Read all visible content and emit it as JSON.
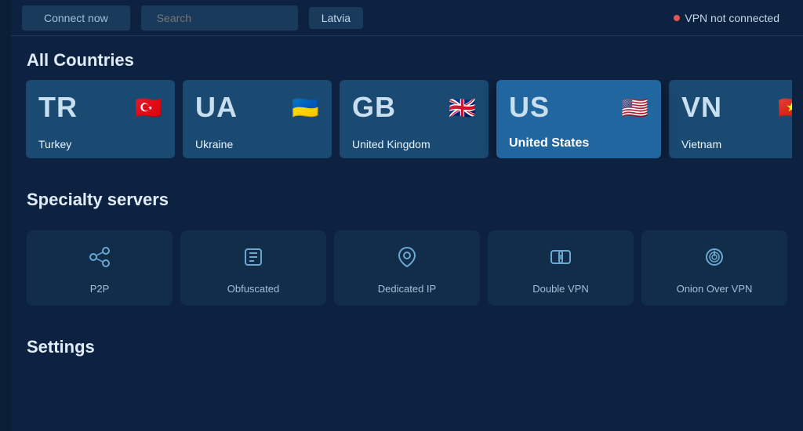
{
  "topbar": {
    "connect_label": "Connect now",
    "search_label": "Search",
    "latvia_label": "Latvia",
    "vpn_status": "VPN not connected"
  },
  "sections": {
    "all_countries_title": "All Countries",
    "specialty_title": "Specialty servers",
    "settings_title": "Settings"
  },
  "country_cards": [
    {
      "code": "TR",
      "name": "Turkey",
      "flag": "🇹🇷",
      "active": false
    },
    {
      "code": "UA",
      "name": "Ukraine",
      "flag": "🇺🇦",
      "active": false
    },
    {
      "code": "GB",
      "name": "United Kingdom",
      "flag": "🇬🇧",
      "active": false
    },
    {
      "code": "US",
      "name": "United States",
      "flag": "🇺🇸",
      "active": true
    },
    {
      "code": "VN",
      "name": "Vietnam",
      "flag": "🇻🇳",
      "active": false
    }
  ],
  "specialty_cards": [
    {
      "id": "p2p",
      "label": "P2P",
      "icon": "p2p"
    },
    {
      "id": "obfuscated",
      "label": "Obfuscated",
      "icon": "obfuscated"
    },
    {
      "id": "dedicated-ip",
      "label": "Dedicated IP",
      "icon": "dedicated"
    },
    {
      "id": "double-vpn",
      "label": "Double VPN",
      "icon": "double"
    },
    {
      "id": "onion-over-vpn",
      "label": "Onion Over VPN",
      "icon": "onion"
    }
  ]
}
